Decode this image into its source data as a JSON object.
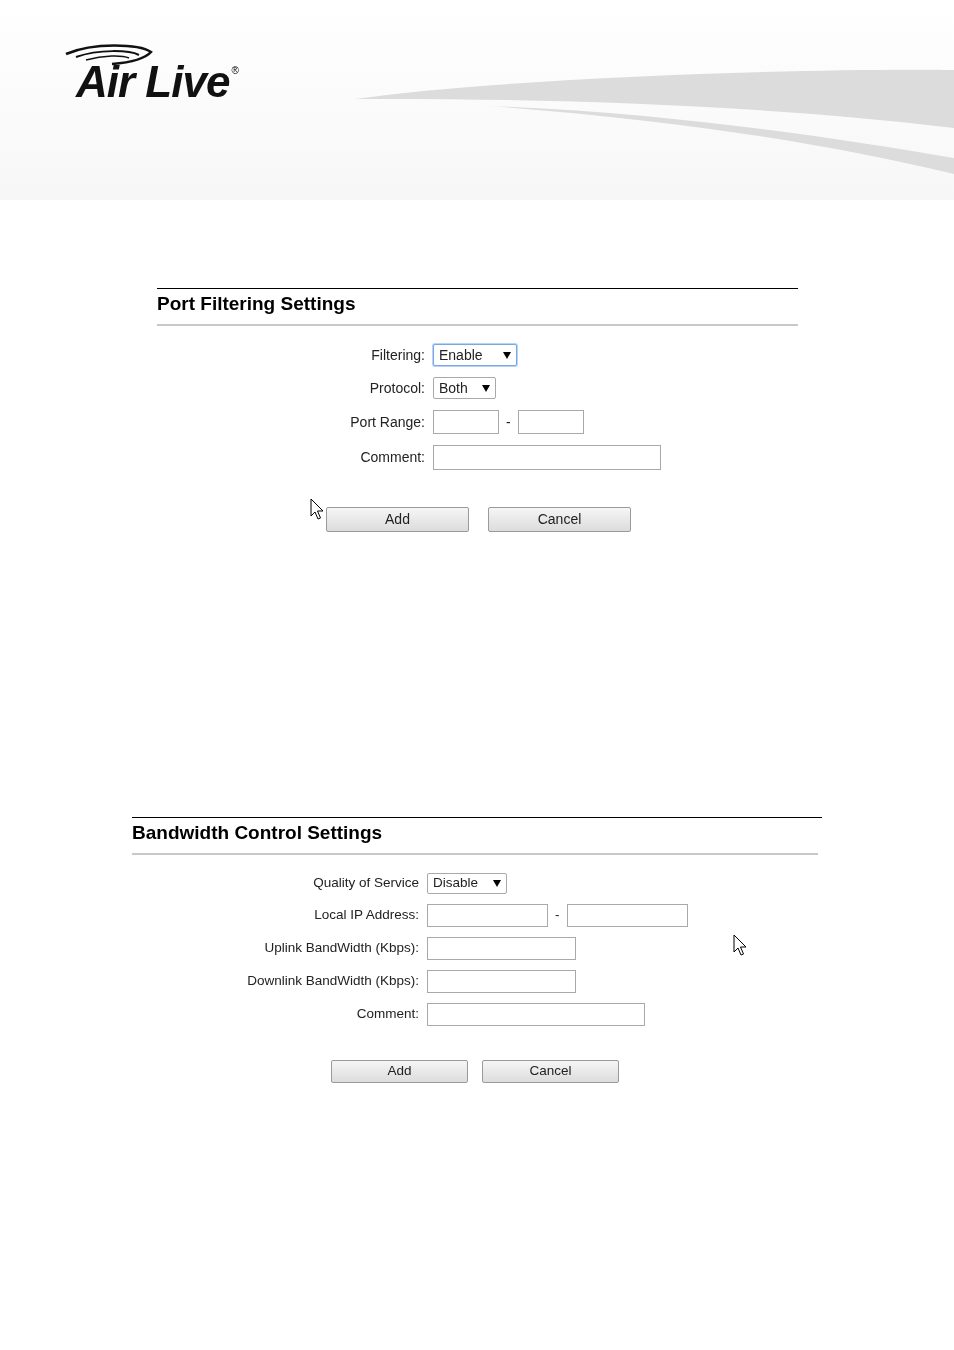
{
  "logo": {
    "text": "Air Live",
    "mark": "®"
  },
  "sections": [
    {
      "title": "Port Filtering Settings",
      "fields": [
        {
          "kind": "select",
          "label": "Filtering:",
          "value": "Enable",
          "focused": true
        },
        {
          "kind": "select",
          "label": "Protocol:",
          "value": "Both",
          "focused": false
        },
        {
          "kind": "range",
          "label": "Port Range:",
          "separator": "-"
        },
        {
          "kind": "text",
          "label": "Comment:"
        }
      ],
      "buttons": [
        "Add",
        "Cancel"
      ]
    },
    {
      "title": "Bandwidth Control Settings",
      "fields": [
        {
          "kind": "select",
          "label": "Quality of Service",
          "value": "Disable",
          "focused": false
        },
        {
          "kind": "range",
          "label": "Local IP Address:",
          "separator": "-"
        },
        {
          "kind": "text",
          "label": "Uplink BandWidth (Kbps):"
        },
        {
          "kind": "text",
          "label": "Downlink BandWidth (Kbps):"
        },
        {
          "kind": "text",
          "label": "Comment:"
        }
      ],
      "buttons": [
        "Add",
        "Cancel"
      ]
    }
  ]
}
